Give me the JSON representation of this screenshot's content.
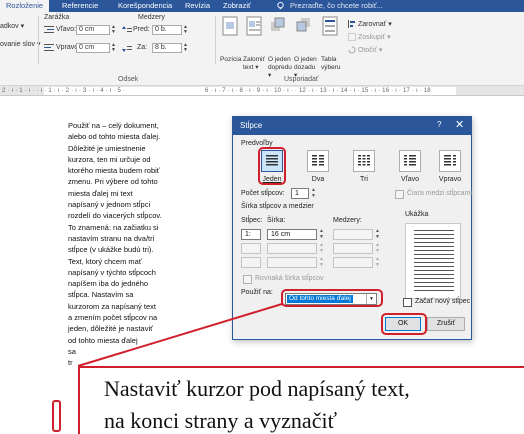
{
  "ribbon": {
    "tabs": [
      "Rozloženie",
      "Referencie",
      "Korešpondencia",
      "Revízia",
      "Zobraziť",
      "Prezraďte, čo chcete robiť..."
    ],
    "left_cut": [
      "adkov ▾",
      "ovanie slov ▾"
    ],
    "indent": {
      "title": "Zarážka",
      "left_label": "Vľavo:",
      "left_value": "0 cm",
      "right_label": "Vpravo:",
      "right_value": "0 cm"
    },
    "spacing": {
      "title": "Medzery",
      "before_label": "Pred:",
      "before_value": "0 b.",
      "after_label": "Za:",
      "after_value": "8 b."
    },
    "group_label_paragraph": "Odsek",
    "arrange_buttons": [
      "Pozícia",
      "Zalomiť text ▾",
      "O jeden dopredu ▾",
      "O jeden dozadu ▾",
      "Tabla výberu"
    ],
    "arrange_right": [
      "Zarovnať ▾",
      "Zoskupiť ▾",
      "Otočiť ▾"
    ],
    "group_label_arrange": "Usporiadať",
    "ruler": "2 · ı · 1 · ı ·  · ı · 1 · ı · 2 · ı · 3 · ı · 4 · ı · 5 ·",
    "ruler_right": "6 · ı · 7 · ı · 8 · ı · 9 · ı · 10 · ı ·  · 12 · ı · 13 · ı · 14 · ı · 15 · ı · 16 · ı · 17 · ı · 18"
  },
  "document": {
    "lines": [
      "Použiť na – celý dokument,",
      "alebo od tohto miesta ďalej.",
      "Dôležité je umiestnenie",
      "kurzora, ten mi určuje od",
      "ktorého miesta budem robiť",
      "zmenu. Pri výbere od tohto",
      "miesta ďalej mi text",
      "napísaný v jednom stĺpci",
      "rozdelí do viacerých stĺpcov.",
      "To znamená: na začiatku si",
      "nastavím stranu na dva/tri",
      "stĺpce (v ukážke budú tri).",
      "Text, ktorý chcem mať",
      "napísaný v týchto stĺpcoch",
      "napíšem iba do jedného",
      "stĺpca. Nastavím sa",
      "kurzorom za napísaný text",
      "a zmením počet stĺpcov na",
      "jeden, dôležité je nastaviť",
      "od tohto miesta ďalej",
      "sa",
      "tr"
    ]
  },
  "dialog": {
    "title": "Stĺpce",
    "help": "?",
    "close": "✕",
    "presets_label": "Predvoľby",
    "presets": [
      "Jeden",
      "Dva",
      "Tri",
      "Vľavo",
      "Vpravo"
    ],
    "count_label": "Počet stĺpcov:",
    "count_value": "1",
    "line_between": "Čiara medzi stĺpcami",
    "width_section": "Šírka stĺpcov a medzier",
    "preview_label": "Ukážka",
    "col_header": "Stĺpec:",
    "width_header": "Šírka:",
    "spacing_header": "Medzery:",
    "row1_num": "1:",
    "row1_width": "16 cm",
    "equal_width": "Rovnaká šírka stĺpcov",
    "apply_label": "Použiť na:",
    "apply_value": "Od tohto miesta ďalej",
    "new_column": "Začať nový stĺpec",
    "ok": "OK",
    "cancel": "Zrušiť"
  },
  "callout": {
    "line1": "Nastaviť kurzor pod napísaný text,",
    "line2": "na konci strany a vyznačiť"
  }
}
